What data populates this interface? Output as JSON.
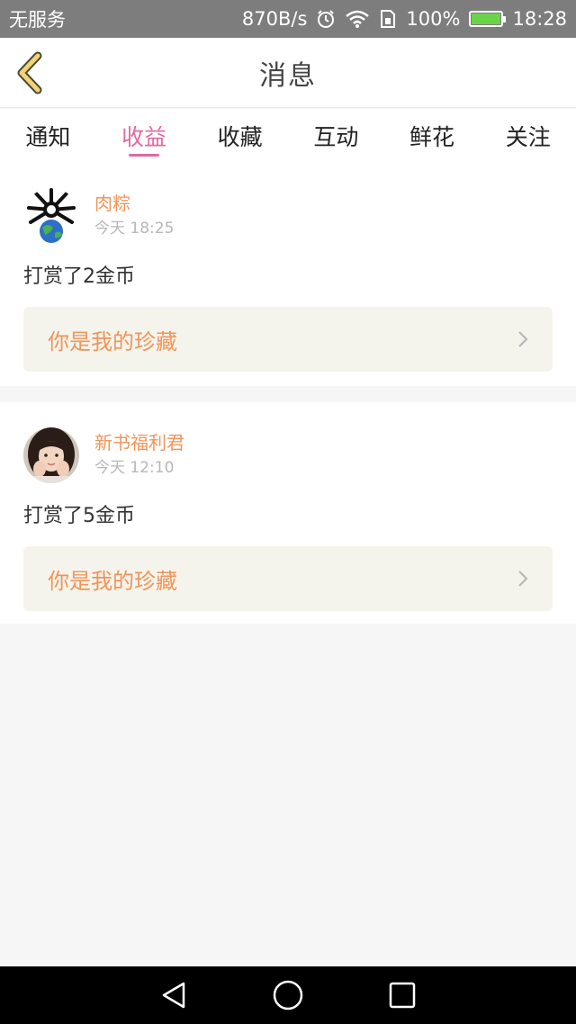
{
  "status_bar": {
    "carrier": "无服务",
    "speed": "870B/s",
    "battery": "100%",
    "time": "18:28"
  },
  "header": {
    "title": "消息"
  },
  "tabs": [
    {
      "label": "通知"
    },
    {
      "label": "收益"
    },
    {
      "label": "收藏"
    },
    {
      "label": "互动"
    },
    {
      "label": "鲜花"
    },
    {
      "label": "关注"
    }
  ],
  "active_tab": "收益",
  "messages": [
    {
      "user": "肉粽",
      "time": "今天 18:25",
      "action": "打赏了2金币",
      "book": "你是我的珍藏"
    },
    {
      "user": "新书福利君",
      "time": "今天 12:10",
      "action": "打赏了5金币",
      "book": "你是我的珍藏"
    }
  ],
  "colors": {
    "accent": "#e06aa0",
    "name": "#f0955a",
    "book_bg": "#f5f4ec"
  }
}
